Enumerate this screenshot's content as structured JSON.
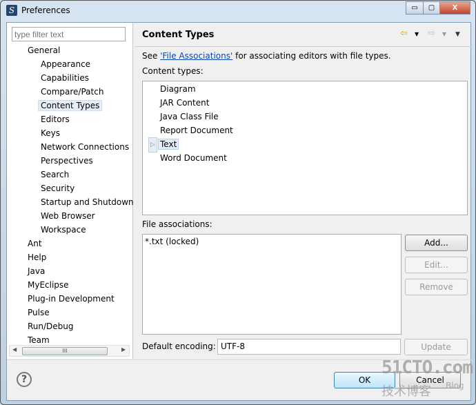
{
  "window": {
    "title": "Preferences",
    "minimize": "▭",
    "maximize": "▢",
    "close": "X"
  },
  "sidebar": {
    "filter_placeholder": "type filter text",
    "items": [
      {
        "label": "General",
        "level": 0
      },
      {
        "label": "Appearance",
        "level": 1
      },
      {
        "label": "Capabilities",
        "level": 1
      },
      {
        "label": "Compare/Patch",
        "level": 1
      },
      {
        "label": "Content Types",
        "level": 1,
        "selected": true
      },
      {
        "label": "Editors",
        "level": 1
      },
      {
        "label": "Keys",
        "level": 1
      },
      {
        "label": "Network Connections",
        "level": 1
      },
      {
        "label": "Perspectives",
        "level": 1
      },
      {
        "label": "Search",
        "level": 1
      },
      {
        "label": "Security",
        "level": 1
      },
      {
        "label": "Startup and Shutdown",
        "level": 1
      },
      {
        "label": "Web Browser",
        "level": 1
      },
      {
        "label": "Workspace",
        "level": 1
      },
      {
        "label": "Ant",
        "level": 0
      },
      {
        "label": "Help",
        "level": 0
      },
      {
        "label": "Java",
        "level": 0
      },
      {
        "label": "MyEclipse",
        "level": 0
      },
      {
        "label": "Plug-in Development",
        "level": 0
      },
      {
        "label": "Pulse",
        "level": 0
      },
      {
        "label": "Run/Debug",
        "level": 0
      },
      {
        "label": "Team",
        "level": 0
      }
    ],
    "scroll_thumb": "III",
    "scroll_left": "◀",
    "scroll_right": "▶"
  },
  "page": {
    "title": "Content Types",
    "back": "⇦",
    "forward": "⇨",
    "dropdown": "▼",
    "desc_prefix": "See ",
    "desc_link": "'File Associations'",
    "desc_suffix": " for associating editors with file types.",
    "content_types_label": "Content types:",
    "content_types": [
      {
        "label": "Diagram"
      },
      {
        "label": "JAR Content"
      },
      {
        "label": "Java Class File"
      },
      {
        "label": "Report Document"
      },
      {
        "label": "Text",
        "selected": true,
        "expandable": true
      },
      {
        "label": "Word Document"
      }
    ],
    "expander": "▷",
    "file_assoc_label": "File associations:",
    "file_assocs": [
      "*.txt (locked)"
    ],
    "add": "Add...",
    "edit": "Edit...",
    "remove": "Remove",
    "encoding_label": "Default encoding:",
    "encoding_value": "UTF-8",
    "update": "Update"
  },
  "footer": {
    "help": "?",
    "ok": "OK",
    "cancel": "Cancel"
  },
  "watermark": {
    "line1": "51CTO.com",
    "line2": "技术博客",
    "line3": "Blog"
  }
}
